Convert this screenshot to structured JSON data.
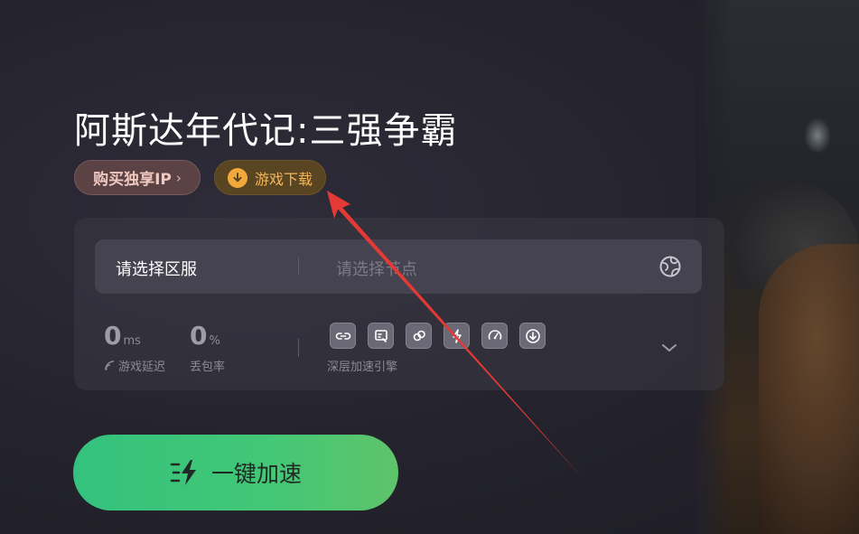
{
  "game": {
    "title": "阿斯达年代记:三强争霸"
  },
  "actions": {
    "buy_ip_label": "购买独享IP",
    "buy_ip_chevron": "›",
    "download_label": "游戏下载"
  },
  "selector": {
    "server_label": "请选择区服",
    "node_placeholder": "请选择节点"
  },
  "stats": {
    "latency_value": "0",
    "latency_unit": "ms",
    "latency_label": "游戏延迟",
    "loss_value": "0",
    "loss_unit": "%",
    "loss_label": "丢包率"
  },
  "engine": {
    "label": "深层加速引擎",
    "icons": [
      "link-icon",
      "screen-icon",
      "rings-icon",
      "bolt-icon",
      "speed-gauge-icon",
      "download-circle-icon"
    ]
  },
  "accelerate": {
    "label": "一键加速"
  },
  "colors": {
    "accent_green": "#3cc47a",
    "download_orange": "#f2a93b",
    "annotation_red": "#e53935"
  }
}
